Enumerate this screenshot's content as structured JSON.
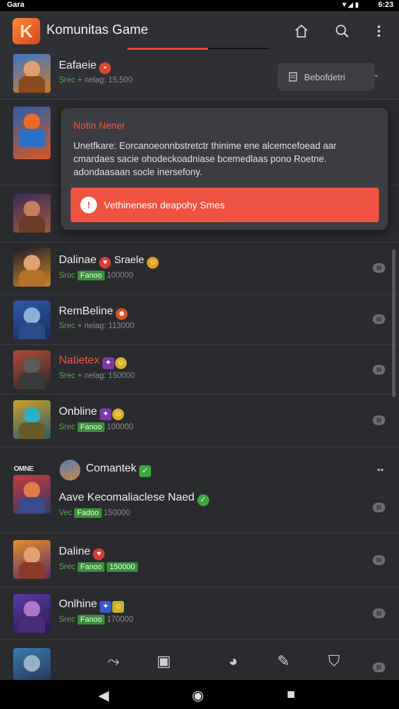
{
  "status_bar": {
    "carrier": "Gara",
    "signal": "▼◢ ▮",
    "time": "6:23"
  },
  "app_bar": {
    "title": "Komunitas Game",
    "logo_glyph": "K",
    "home_icon": "home-icon",
    "search_icon": "search-icon",
    "menu_icon": "more-vert-icon"
  },
  "top_card": {
    "title": "Eafaeie",
    "subtitle_green": "Srec",
    "subtitle_rest": "+ nelag: 15.500",
    "button_label": "Bebofdetri",
    "button_icon": "document-icon"
  },
  "popup": {
    "title": "Notin Nener",
    "body": "Unetfkare: Eorcanoeonnbstretctr thinime ene alcemcefoead aar cmardaes sacie ohodeckoadniase bcemedlaas pono Roetne. adondaasaan socle inersefony.",
    "button_label": "Vethinenesn deapohy Smes",
    "button_icon": "alert-icon"
  },
  "rows": [
    {
      "title": "Dalinae",
      "title_red": false,
      "sub_green": "Sroc",
      "badge": "Fanoo",
      "sub_rest": "100000",
      "toggle": "III"
    },
    {
      "title": "RemBeline",
      "title_red": false,
      "sub_green": "Srec",
      "badge": "",
      "sub_rest": "+ nelag: 113000",
      "toggle": "III"
    },
    {
      "title": "Natietex",
      "title_red": true,
      "sub_green": "Srec",
      "badge": "",
      "sub_rest": "+ nelag: 150000",
      "toggle": "III"
    },
    {
      "title": "Onbline",
      "title_red": false,
      "sub_green": "Srec",
      "badge": "Fanoo",
      "sub_rest": "100000",
      "toggle": "III"
    },
    {
      "title": "Aave Kecomaliaclese Naed",
      "title_red": false,
      "sub_green": "Vec",
      "badge": "Fadoo",
      "sub_rest": "150000",
      "toggle": "III",
      "prefix": "Comantek",
      "tag": "OMNE"
    },
    {
      "title": "Daline",
      "title_red": false,
      "sub_green": "Srec",
      "badge": "Fanoo",
      "sub_rest": "150000",
      "toggle": "III",
      "badge2": "150000"
    },
    {
      "title": "Onlhine",
      "title_red": false,
      "sub_green": "Srec",
      "badge": "Fanoo",
      "sub_rest": "170000",
      "toggle": "III"
    }
  ],
  "colors": {
    "accent": "#ef5240",
    "badge_green": "#3b8f3a",
    "background": "#2a2b2f"
  }
}
